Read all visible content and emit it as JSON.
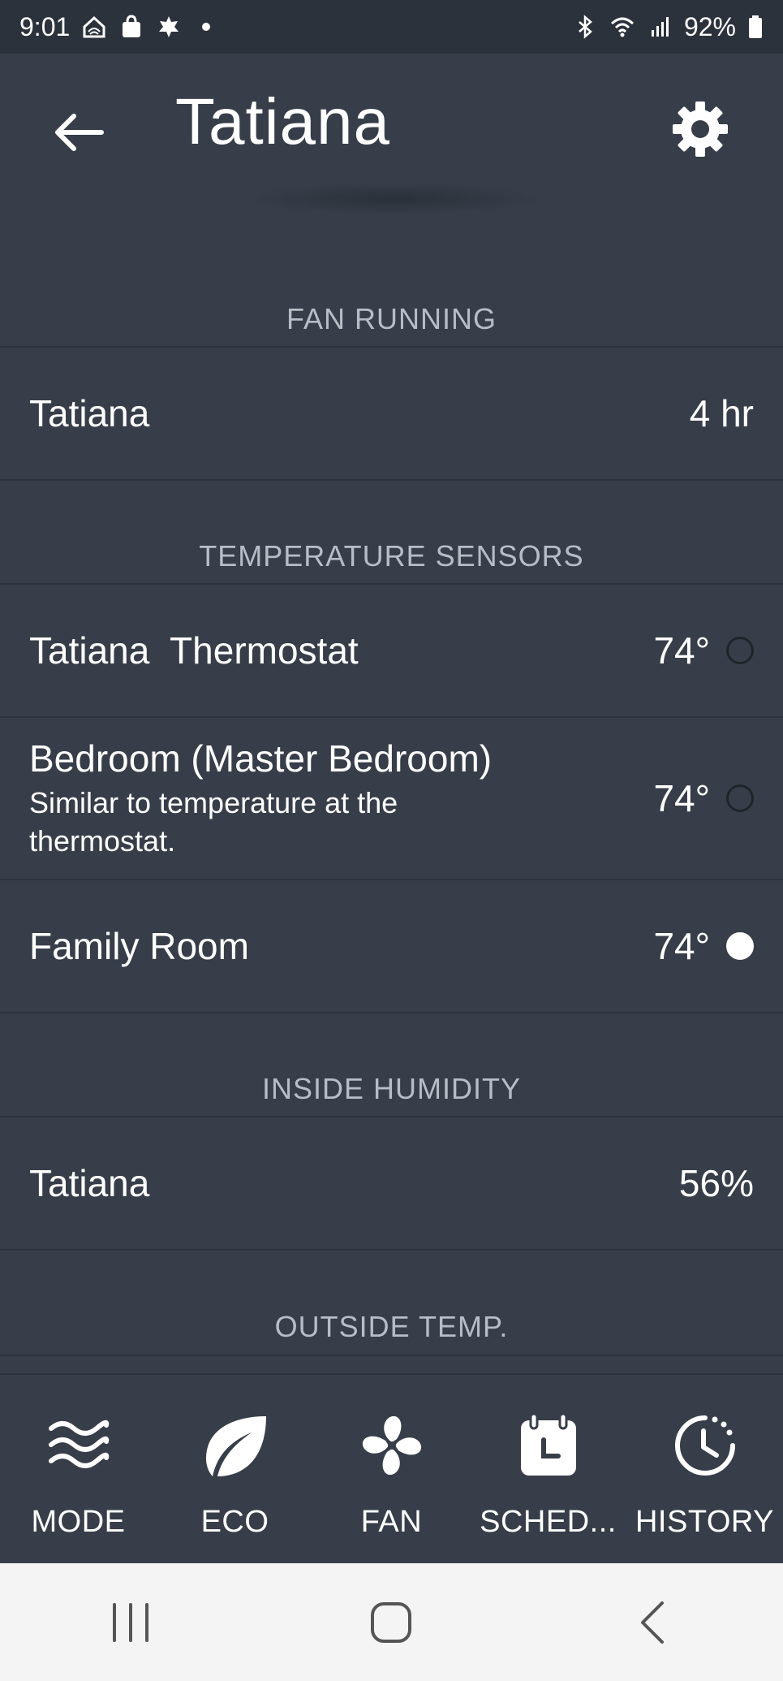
{
  "status_bar": {
    "time": "9:01",
    "battery": "92%",
    "left_icons": [
      "home-icon",
      "shopping-bag-icon",
      "leaf-notification-icon",
      "dot-icon"
    ],
    "right_icons": [
      "bluetooth-icon",
      "wifi-icon",
      "signal-icon",
      "battery-icon"
    ]
  },
  "app_bar": {
    "title": "Tatiana",
    "back_icon": "arrow-left-icon",
    "settings_icon": "gear-icon"
  },
  "sections": {
    "fan_running": {
      "header": "FAN RUNNING",
      "rows": [
        {
          "label": "Tatiana",
          "value": "4 hr"
        }
      ]
    },
    "temperature_sensors": {
      "header": "TEMPERATURE SENSORS",
      "rows": [
        {
          "label": "Tatiana  Thermostat",
          "value": "74°",
          "selected": false
        },
        {
          "label": "Bedroom (Master Bedroom)",
          "sub": "Similar to temperature at the thermostat.",
          "value": "74°",
          "selected": false
        },
        {
          "label": "Family Room",
          "value": "74°",
          "selected": true
        }
      ]
    },
    "inside_humidity": {
      "header": "INSIDE HUMIDITY",
      "rows": [
        {
          "label": "Tatiana",
          "value": "56%"
        }
      ]
    },
    "outside_temp": {
      "header": "OUTSIDE TEMP."
    }
  },
  "bottom_nav": [
    {
      "label": "MODE",
      "icon": "waves-icon"
    },
    {
      "label": "ECO",
      "icon": "leaf-icon"
    },
    {
      "label": "FAN",
      "icon": "fan-icon"
    },
    {
      "label": "SCHED...",
      "icon": "schedule-icon"
    },
    {
      "label": "HISTORY",
      "icon": "history-icon"
    }
  ],
  "system_nav": {
    "icons": [
      "recent-apps-icon",
      "home-button-icon",
      "back-nav-icon"
    ]
  },
  "colors": {
    "background": "#373e49",
    "status_bar": "#2c323b",
    "divider": "#2d333c",
    "header_text": "#b7bdc6",
    "system_nav": "#f4f4f4"
  }
}
